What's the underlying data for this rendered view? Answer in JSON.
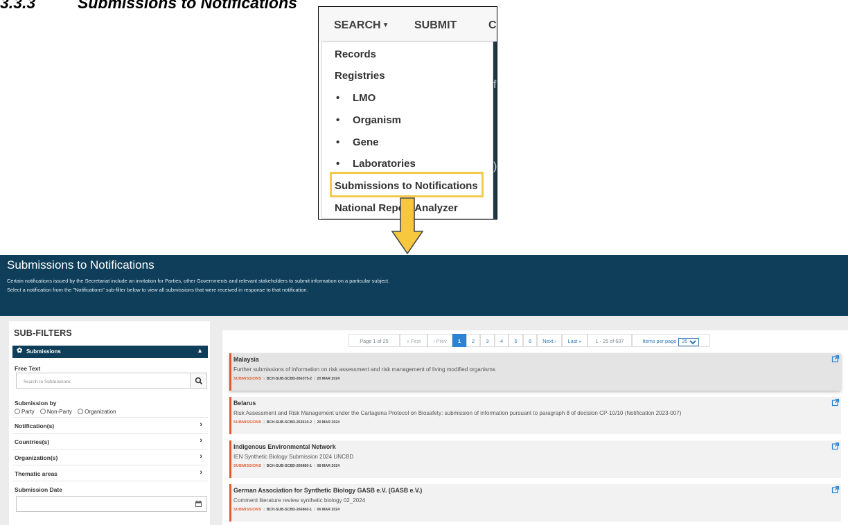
{
  "doc_heading": {
    "number": "3.3.3",
    "title": "Submissions to Notifications"
  },
  "dropdown": {
    "nav": {
      "search": "SEARCH",
      "submit": "SUBMIT",
      "partial": "C"
    },
    "items": [
      "Records",
      "Registries"
    ],
    "sub_items": [
      "LMO",
      "Organism",
      "Gene",
      "Laboratories"
    ],
    "highlighted": "Submissions to Notifications",
    "last": "National Report Analyzer",
    "highlight_color": "#f5c94a"
  },
  "app": {
    "title": "Submissions to Notifications",
    "desc_line1": "Certain notifications issued by the Secretariat include an invitation for Parties, other Governments and relevant stakeholders to submit information on a particular subject.",
    "desc_line2": "Select a notification from the \"Notifications\" sub-filter below to view all submissions that were received in response to that notification.",
    "brand_color": "#0e3e59"
  },
  "subfilters": {
    "title": "SUB-FILTERS",
    "section": "Submissions",
    "free_text_label": "Free Text",
    "search_placeholder": "Search in Submissions",
    "submission_by_label": "Submission by",
    "radio_options": [
      "Party",
      "Non-Party",
      "Organization"
    ],
    "rows": [
      "Notification(s)",
      "Countries(s)",
      "Organization(s)",
      "Thematic areas"
    ],
    "date_label": "Submission Date"
  },
  "pagination": {
    "page_info": "Page 1 of 25",
    "first": "« First",
    "prev": "‹ Prev",
    "pages": [
      "1",
      "2",
      "3",
      "4",
      "5",
      "6"
    ],
    "next": "Next ›",
    "last": "Last »",
    "range": "1 - 25 of 607",
    "per_page_label": "Items per page",
    "per_page_value": "25"
  },
  "results": [
    {
      "title": "Malaysia",
      "description": "Further submissions of information on risk assessment and risk management of living modified organisms",
      "tag": "SUBMISSIONS",
      "id": "BCH-SUB-SCBD-266375-2",
      "date": "20 MAR 2024"
    },
    {
      "title": "Belarus",
      "description": "Risk Assessment and Risk Management under the Cartagena Protocol on Biosafety: submission of information pursuant to paragraph 8 of decision CP-10/10 (Notification 2023-007)",
      "tag": "SUBMISSIONS",
      "id": "BCH-SUB-SCBD-263610-2",
      "date": "20 MAR 2024"
    },
    {
      "title": "Indigenous Environmental Network",
      "description": "IEN Synthetic Biology Submission 2024 UNCBD",
      "tag": "SUBMISSIONS",
      "id": "BCH-SUB-SCBD-266880-1",
      "date": "08 MAR 2024"
    },
    {
      "title": "German Association for Synthetic Biology GASB e.V. (GASB e.V.)",
      "description": "Comment literature review synthetic biology 02_2024",
      "tag": "SUBMISSIONS",
      "id": "BCH-SUB-SCBD-266860-1",
      "date": "06 MAR 2024"
    }
  ]
}
